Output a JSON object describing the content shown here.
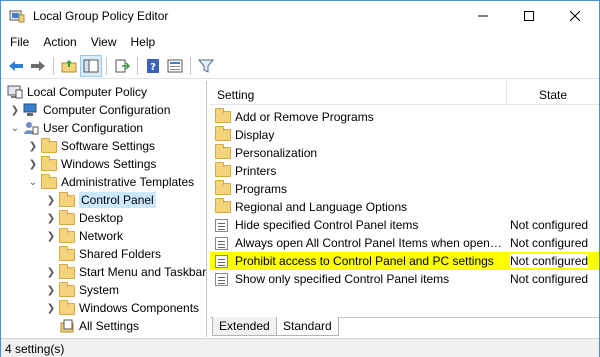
{
  "window": {
    "title": "Local Group Policy Editor"
  },
  "menu": [
    "File",
    "Action",
    "View",
    "Help"
  ],
  "toolbar_icons": [
    "back-arrow-icon",
    "forward-arrow-icon",
    "up-folder-icon",
    "show-hide-tree-icon",
    "export-list-icon",
    "help-icon",
    "properties-icon",
    "filter-icon"
  ],
  "tree": [
    {
      "label": "Local Computer Policy",
      "icon": "computer-policy-icon"
    },
    {
      "label": "Computer Configuration",
      "icon": "computer-icon"
    },
    {
      "label": "User Configuration",
      "icon": "user-icon"
    },
    {
      "label": "Software Settings",
      "icon": "folder-icon"
    },
    {
      "label": "Windows Settings",
      "icon": "folder-icon"
    },
    {
      "label": "Administrative Templates",
      "icon": "folder-icon"
    },
    {
      "label": "Control Panel",
      "icon": "folder-icon"
    },
    {
      "label": "Desktop",
      "icon": "folder-icon"
    },
    {
      "label": "Network",
      "icon": "folder-icon"
    },
    {
      "label": "Shared Folders",
      "icon": "folder-icon"
    },
    {
      "label": "Start Menu and Taskbar",
      "icon": "folder-icon"
    },
    {
      "label": "System",
      "icon": "folder-icon"
    },
    {
      "label": "Windows Components",
      "icon": "folder-icon"
    },
    {
      "label": "All Settings",
      "icon": "all-settings-icon"
    }
  ],
  "list": {
    "header_setting": "Setting",
    "header_state": "State",
    "rows": [
      {
        "name": "Add or Remove Programs",
        "state": "",
        "icon": "folder-icon"
      },
      {
        "name": "Display",
        "state": "",
        "icon": "folder-icon"
      },
      {
        "name": "Personalization",
        "state": "",
        "icon": "folder-icon"
      },
      {
        "name": "Printers",
        "state": "",
        "icon": "folder-icon"
      },
      {
        "name": "Programs",
        "state": "",
        "icon": "folder-icon"
      },
      {
        "name": "Regional and Language Options",
        "state": "",
        "icon": "folder-icon"
      },
      {
        "name": "Hide specified Control Panel items",
        "state": "Not configured",
        "icon": "policy-setting-icon"
      },
      {
        "name": "Always open All Control Panel Items when openin...",
        "state": "Not configured",
        "icon": "policy-setting-icon"
      },
      {
        "name": "Prohibit access to Control Panel and PC settings",
        "state": "Not configured",
        "icon": "policy-setting-icon"
      },
      {
        "name": "Show only specified Control Panel items",
        "state": "Not configured",
        "icon": "policy-setting-icon"
      }
    ]
  },
  "tabs": [
    "Extended",
    "Standard"
  ],
  "status": "4 setting(s)",
  "colors": {
    "highlight": "#ffff00",
    "selected": "#cce8ff",
    "border": "#4a8fd4"
  }
}
